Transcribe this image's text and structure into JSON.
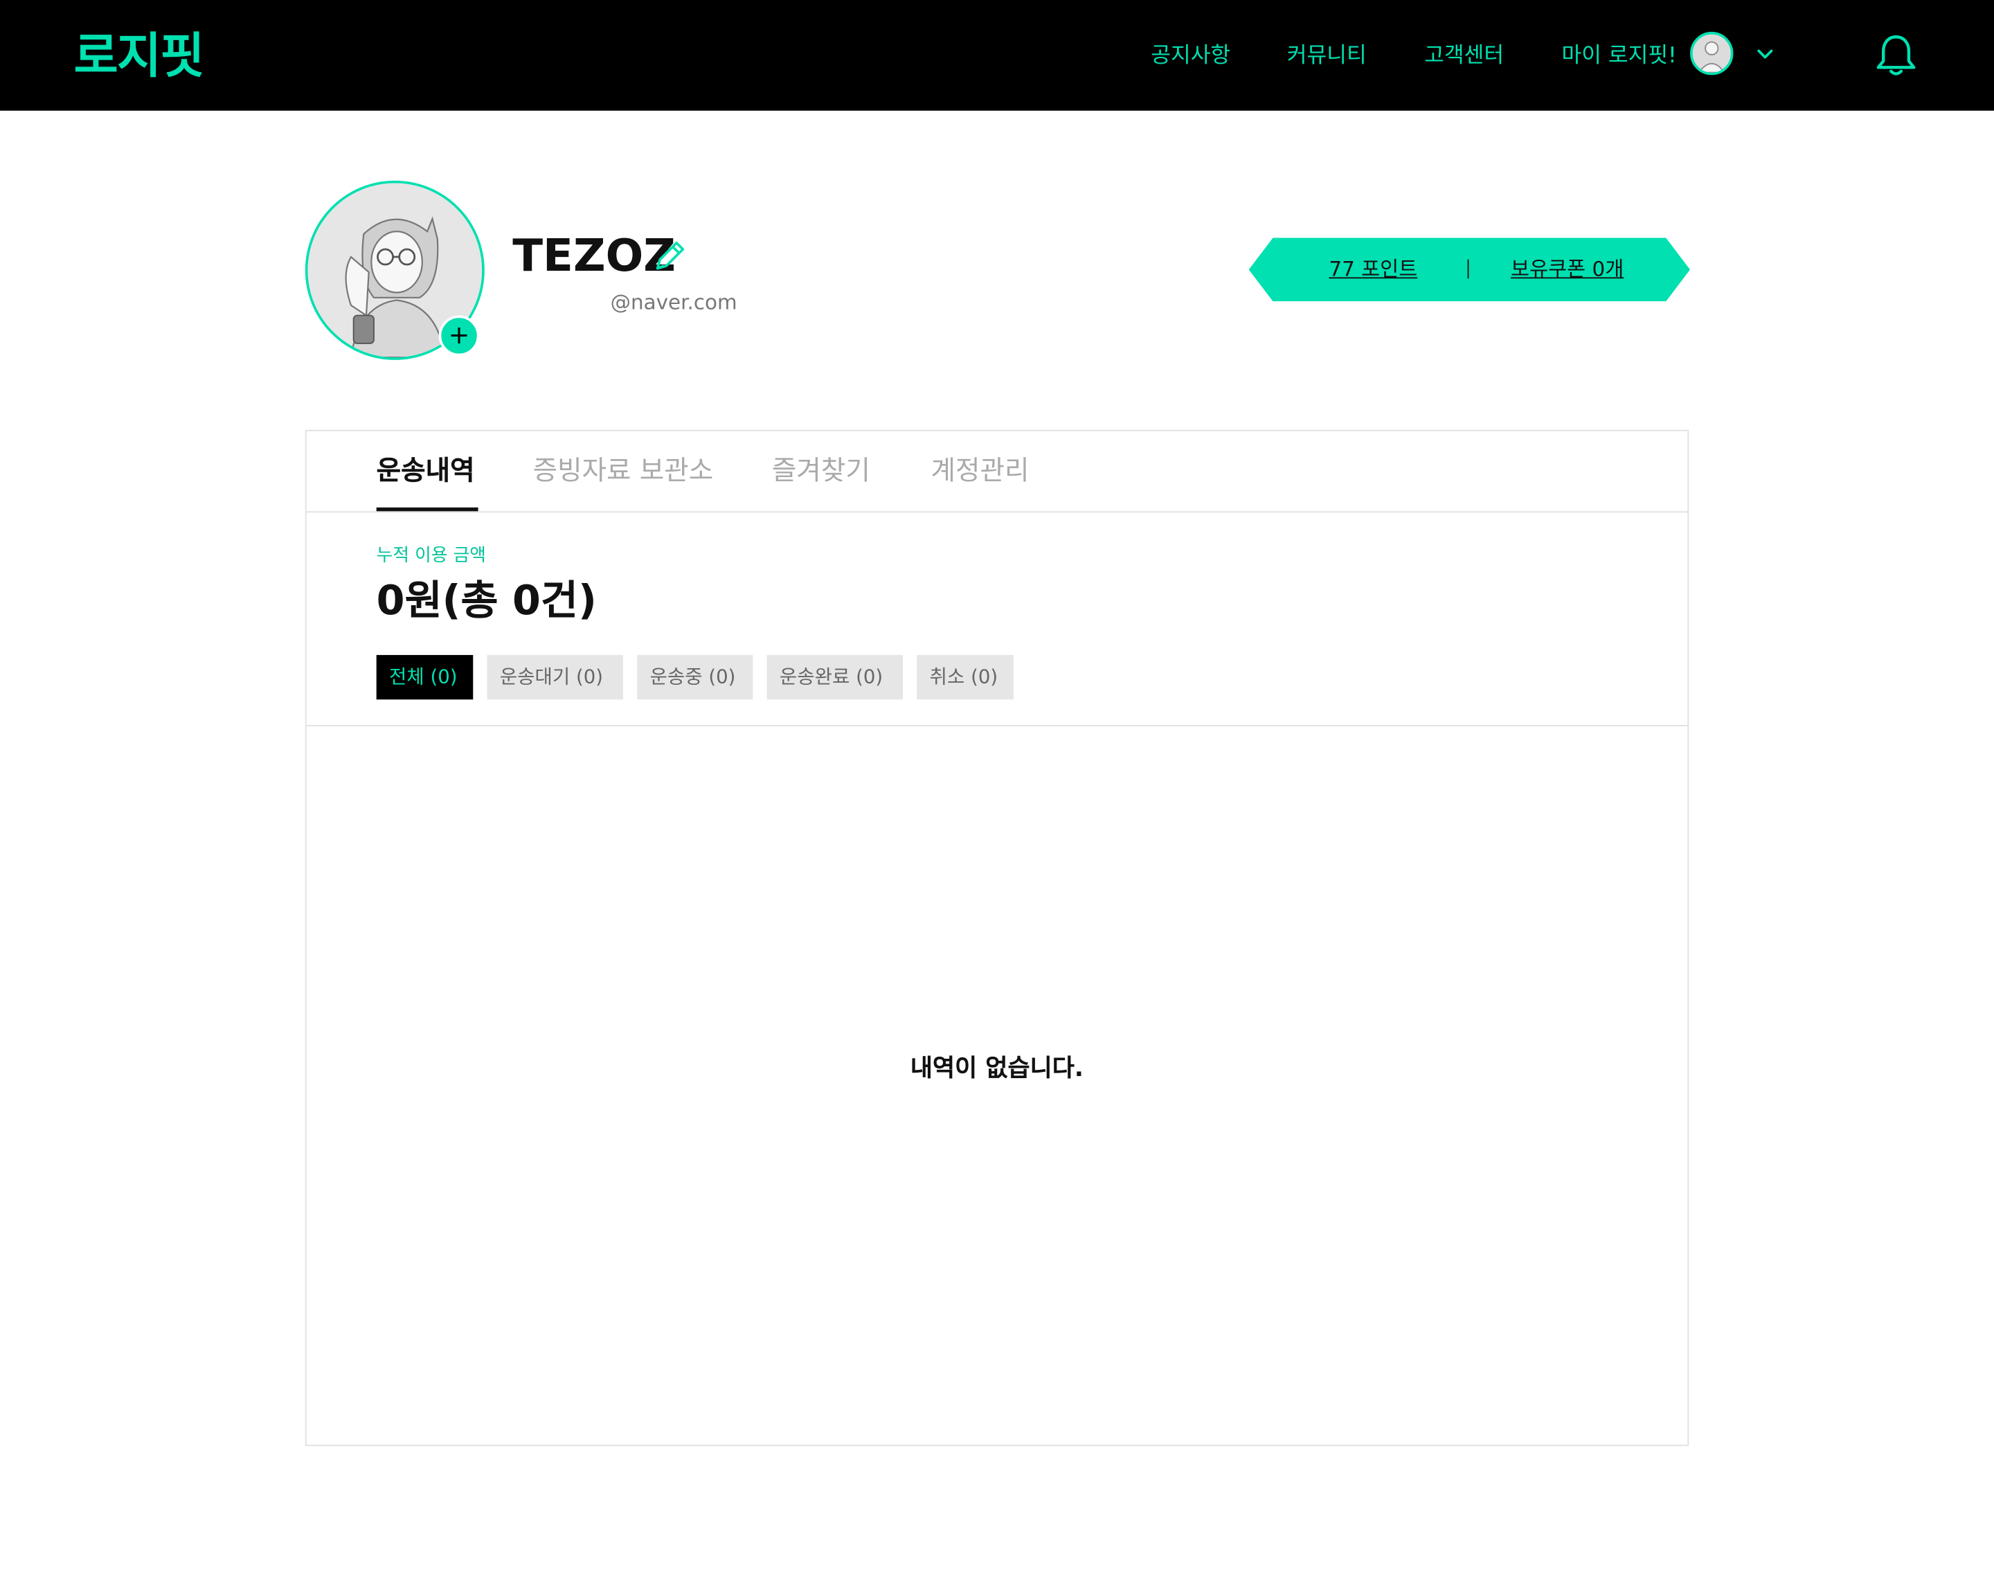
{
  "header": {
    "logo": "로지핏",
    "nav": {
      "notice": "공지사항",
      "community": "커뮤니티",
      "support": "고객센터",
      "my": "마이 로지핏!"
    }
  },
  "profile": {
    "name": "TEZOZ",
    "email": "@naver.com",
    "points_label": "77 포인트",
    "coupons_label": "보유쿠폰 0개"
  },
  "tabs": [
    "운송내역",
    "증빙자료 보관소",
    "즐겨찾기",
    "계정관리"
  ],
  "summary": {
    "label": "누적 이용 금액",
    "value": "0원(총 0건)"
  },
  "filters": [
    "전체 (0)",
    "운송대기 (0)",
    "운송중 (0)",
    "운송완료 (0)",
    "취소 (0)"
  ],
  "empty_message": "내역이 없습니다.",
  "colors": {
    "accent": "#00e0b0",
    "header_bg": "#000000",
    "muted_text": "#aaaaaa",
    "chip_bg": "#e6e6e6"
  },
  "icons": {
    "edit": "pencil-icon",
    "notifications": "bell-icon",
    "dropdown": "chevron-down-icon",
    "add_photo": "plus-icon"
  }
}
